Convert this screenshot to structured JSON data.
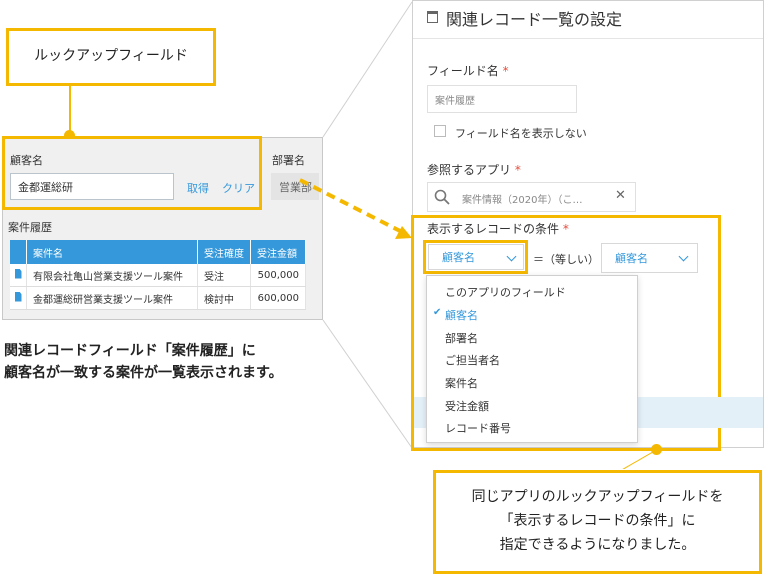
{
  "callouts": {
    "lookup_field": "ルックアップフィールド",
    "note_line1": "同じアプリのルックアップフィールドを",
    "note_line2": "「表示するレコードの条件」に",
    "note_line3": "指定できるようになりました。"
  },
  "caption": {
    "line1": "関連レコードフィールド「案件履歴」に",
    "line2": "顧客名が一致する案件が一覧表示されます。"
  },
  "form": {
    "customer_label": "顧客名",
    "customer_value": "金都運総研",
    "get_label": "取得",
    "clear_label": "クリア",
    "department_label": "部署名",
    "department_value": "営業部",
    "related_records_label": "案件履歴",
    "table": {
      "headers": [
        "案件名",
        "受注確度",
        "受注金額"
      ],
      "rows": [
        [
          "有限会社亀山営業支援ツール案件",
          "受注",
          "500,000"
        ],
        [
          "金都運総研営業支援ツール案件",
          "検討中",
          "600,000"
        ]
      ]
    }
  },
  "settings": {
    "title": "関連レコード一覧の設定",
    "field_name_label": "フィールド名",
    "required_mark": "*",
    "field_name_value": "案件履歴",
    "hide_name_label": "フィールド名を表示しない",
    "hide_name_checked": false,
    "ref_app_label": "参照するアプリ",
    "ref_app_value": "案件情報（2020年）（こ…",
    "condition_label": "表示するレコードの条件",
    "condition_field": "顧客名",
    "operator": "＝（等しい）",
    "condition_target": "顧客名",
    "menu_items": [
      "このアプリのフィールド",
      "顧客名",
      "部署名",
      "ご担当者名",
      "案件名",
      "受注金額",
      "レコード番号"
    ],
    "selected_index": 1
  },
  "colors": {
    "accent_yellow": "#f5b800",
    "kintone_blue": "#3498db",
    "required_red": "#e74c3c"
  }
}
